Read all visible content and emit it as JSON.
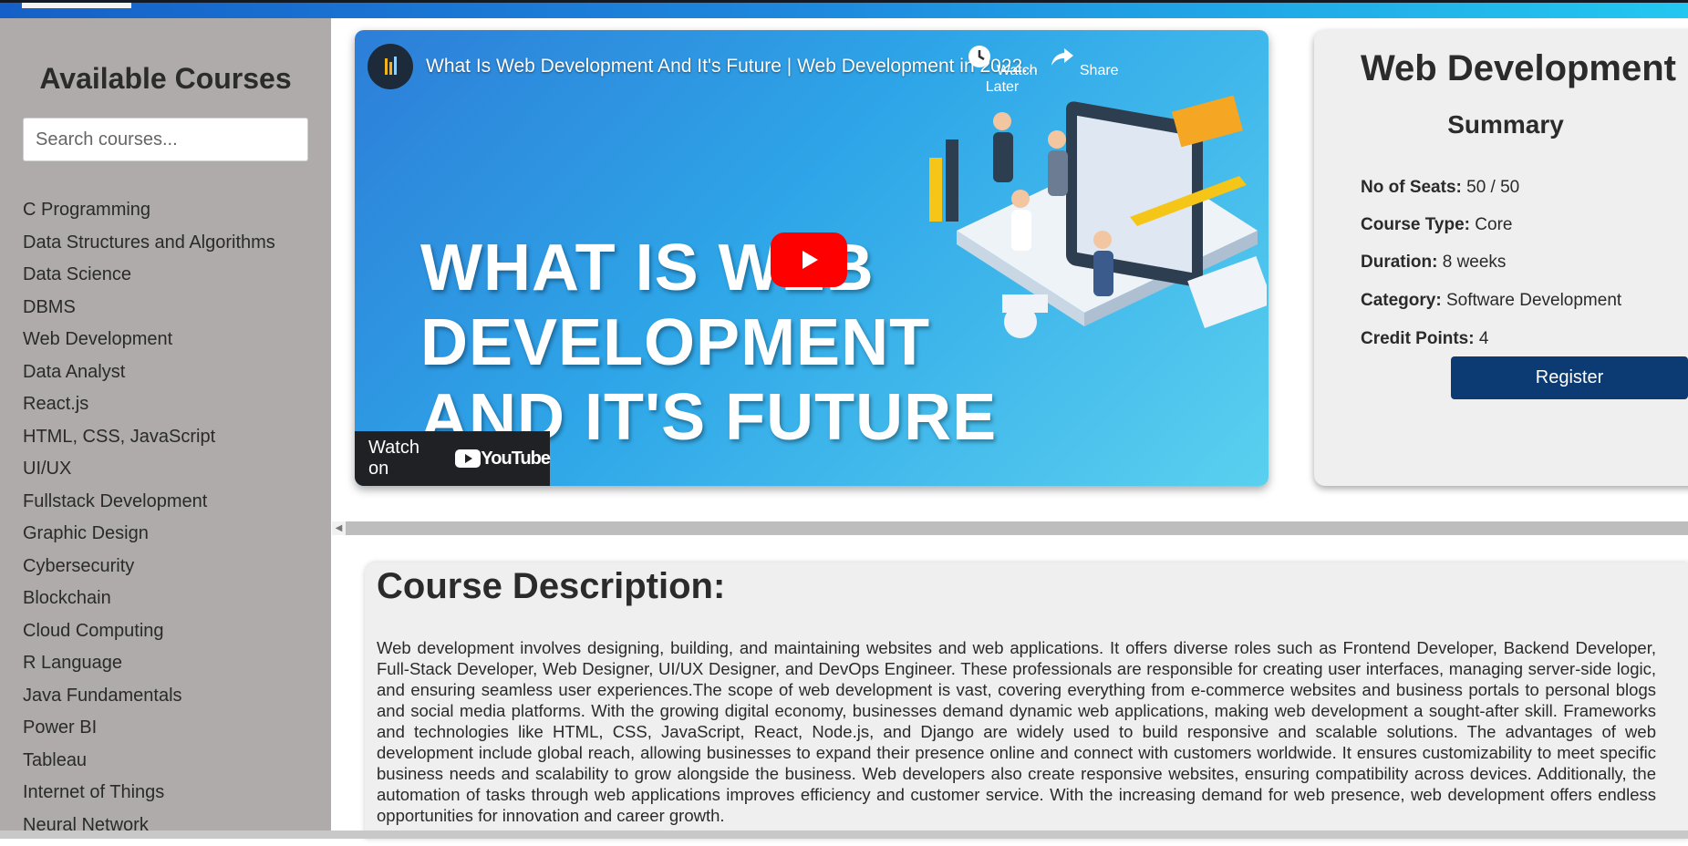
{
  "sidebar": {
    "title": "Available Courses",
    "search_placeholder": "Search courses...",
    "courses": [
      "C Programming",
      "Data Structures and Algorithms",
      "Data Science",
      "DBMS",
      "Web Development",
      "Data Analyst",
      "React.js",
      "HTML, CSS, JavaScript",
      "UI/UX",
      "Fullstack Development",
      "Graphic Design",
      "Cybersecurity",
      "Blockchain",
      "Cloud Computing",
      "R Language",
      "Java Fundamentals",
      "Power BI",
      "Tableau",
      "Internet of Things",
      "Neural Network"
    ]
  },
  "video": {
    "channel_logo": "simplilearn",
    "title": "What Is Web Development And It's Future | Web Development in 2022...",
    "watch_later_label": "Watch Later",
    "share_label": "Share",
    "headline": "WHAT IS WEB\nDEVELOPMENT\nAND IT'S FUTURE",
    "watch_on_label": "Watch on",
    "youtube_label": "YouTube"
  },
  "summary": {
    "course_title": "Web Development",
    "heading": "Summary",
    "seats_label": "No of Seats:",
    "seats_value": "50 / 50",
    "type_label": "Course Type:",
    "type_value": "Core",
    "duration_label": "Duration:",
    "duration_value": "8 weeks",
    "category_label": "Category:",
    "category_value": "Software Development",
    "credits_label": "Credit Points:",
    "credits_value": "4",
    "register_label": "Register"
  },
  "description": {
    "heading": "Course Description:",
    "text": "Web development involves designing, building, and maintaining websites and web applications. It offers diverse roles such as Frontend Developer, Backend Developer, Full-Stack Developer, Web Designer, UI/UX Designer, and DevOps Engineer. These professionals are responsible for creating user interfaces, managing server-side logic, and ensuring seamless user experiences.The scope of web development is vast, covering everything from e-commerce websites and business portals to personal blogs and social media platforms. With the growing digital economy, businesses demand dynamic web applications, making web development a sought-after skill. Frameworks and technologies like HTML, CSS, JavaScript, React, Node.js, and Django are widely used to build responsive and scalable solutions. The advantages of web development include global reach, allowing businesses to expand their presence online and connect with customers worldwide. It ensures customizability to meet specific business needs and scalability to grow alongside the business. Web developers also create responsive websites, ensuring compatibility across devices. Additionally, the automation of tasks through web applications improves efficiency and customer service. With the increasing demand for web presence, web development offers endless opportunities for innovation and career growth."
  },
  "colors": {
    "sidebar_bg": "#afabab",
    "register_bg": "#0c3b73",
    "play_button": "#ff0000",
    "card_bg": "#efefef"
  }
}
